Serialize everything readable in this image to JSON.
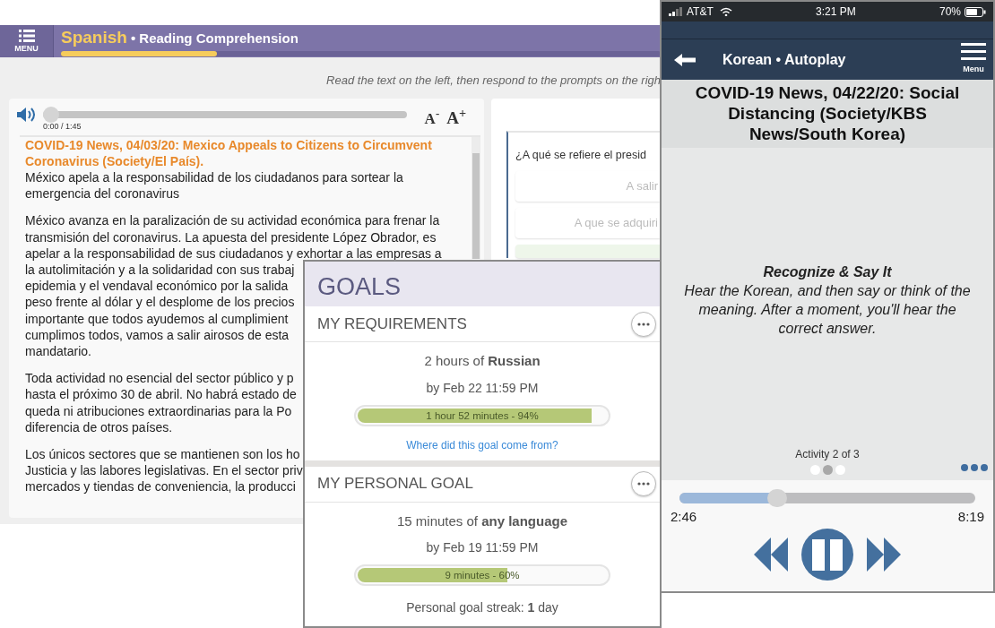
{
  "reading_app": {
    "menu_label": "MENU",
    "language": "Spanish",
    "activity": "• Reading Comprehension",
    "progress": {
      "level": 0.26
    },
    "instruction": "Read the text on the left, then respond to the prompts on the righ",
    "player": {
      "level": 0,
      "time": "0:00 / 1:45",
      "font_buttons": [
        "A$^{-}$",
        "A$^{+}$"
      ]
    },
    "article": {
      "title_lines": [
        "COVID-19 News, 04/03/20: Mexico Appeals to Citizens to Circumvent",
        "Coronavirus (Society/El País)."
      ],
      "paragraphs": [
        {
          "lines": [
            "México apela a la responsabilidad de los ciudadanos para sortear la",
            "emergencia del coronavirus"
          ]
        },
        {
          "lines": [
            "México avanza en la paralización de su actividad económica para frenar la",
            "transmisión del coronavirus. La apuesta del presidente López Obrador, es",
            "apelar a la responsabilidad de sus ciudadanos y exhortar a las empresas a",
            "la autolimitación y a la solidaridad con sus trabaj",
            "epidemia y el vendaval económico por la salida",
            "peso frente al dólar y el desplome de los precios",
            "importante que todos ayudemos al cumplimient",
            "cumplimos todos, vamos a salir airosos de esta",
            "mandatario."
          ]
        },
        {
          "lines": [
            "Toda actividad no esencial del sector público y p",
            "hasta el próximo 30 de abril. No habrá estado de",
            "queda ni atribuciones extraordinarias para la Po",
            "diferencia de otros países."
          ]
        },
        {
          "lines": [
            "Los únicos sectores que se mantienen son los ho",
            "Justicia y las labores legislativas. En el sector priv",
            "mercados y tiendas de conveniencia, la producci"
          ]
        }
      ]
    },
    "question": {
      "prompt": "¿A qué se refiere el presid",
      "options": [
        {
          "text": "A salir",
          "selected": false
        },
        {
          "text": "A que se adquiri",
          "selected": false
        },
        {
          "selected": true
        }
      ]
    }
  },
  "goals": {
    "title": "GOALS",
    "sections": [
      {
        "heading": "MY REQUIREMENTS",
        "goal": "2 hours of **Russian**",
        "deadline": "by Feb 22 11:59 PM",
        "progress": {
          "level": 0.94,
          "label": "1 hour 52 minutes - 94%"
        },
        "link": "Where did this goal come from?"
      },
      {
        "heading": "MY PERSONAL GOAL",
        "goal": "15 minutes of **any language**",
        "deadline": "by Feb 19 11:59 PM",
        "progress": {
          "level": 0.6,
          "label": "9 minutes - 60%"
        },
        "streak": "Personal goal streak: **1** day"
      }
    ]
  },
  "phone": {
    "status_bar": {
      "carrier": "AT&T",
      "time": "3:21 PM",
      "battery": "70%"
    },
    "header": {
      "title": "Korean • Autoplay",
      "menu_label": "Menu"
    },
    "lesson_title": "COVID-19 News, 04/22/20: Social Distancing (Society/KBS News/South Korea)",
    "prompt": {
      "heading": "Recognize & Say It",
      "text": "Hear the Korean, and then say or think of the meaning. After a moment, you'll hear the correct answer."
    },
    "activity_label": "Activity 2 of 3",
    "pager": [
      {
        "selected": false
      },
      {
        "selected": true
      },
      {
        "selected": false
      }
    ],
    "player": {
      "level": 0.33,
      "elapsed": "2:46",
      "total": "8:19"
    }
  }
}
